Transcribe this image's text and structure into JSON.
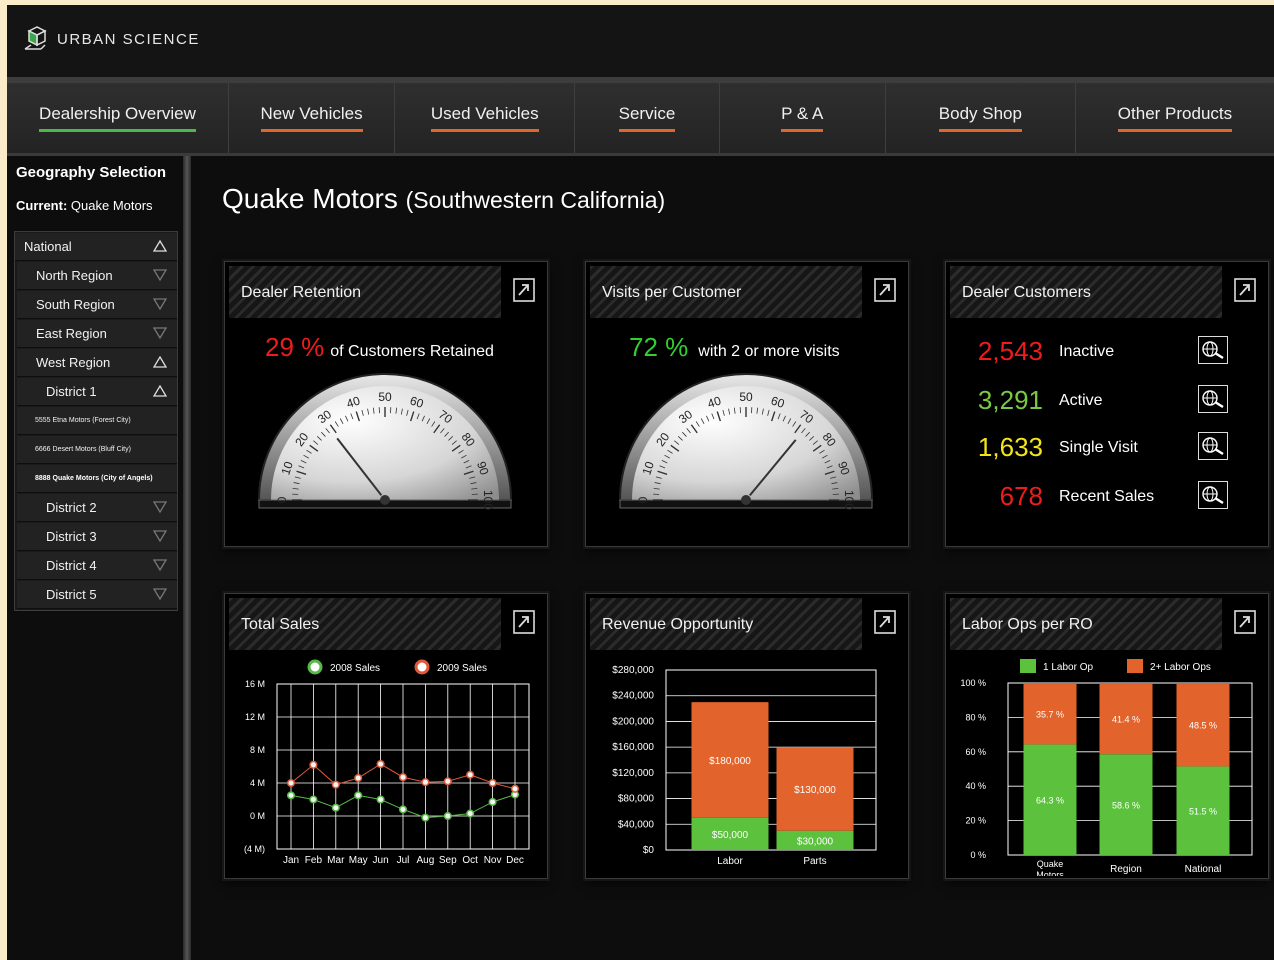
{
  "app": {
    "logo_text": "URBAN SCIENCE"
  },
  "nav": {
    "tabs": [
      {
        "label": "Dealership Overview",
        "active": true
      },
      {
        "label": "New Vehicles"
      },
      {
        "label": "Used Vehicles"
      },
      {
        "label": "Service"
      },
      {
        "label": "P & A"
      },
      {
        "label": "Body Shop"
      },
      {
        "label": "Other Products"
      }
    ]
  },
  "sidebar": {
    "title": "Geography Selection",
    "current_label": "Current:",
    "current_value": "Quake Motors",
    "items": [
      {
        "label": "National",
        "icon": "triangle-up-icon"
      },
      {
        "label": "North Region",
        "icon": "triangle-down-icon"
      },
      {
        "label": "South Region",
        "icon": "triangle-down-icon"
      },
      {
        "label": "East Region",
        "icon": "triangle-down-icon"
      },
      {
        "label": "West Region",
        "icon": "triangle-up-icon"
      },
      {
        "label": "District 1",
        "icon": "triangle-up-icon"
      },
      {
        "label": "5555 Etna Motors (Forest City)"
      },
      {
        "label": "6666 Desert Motors (Bluff City)"
      },
      {
        "label": "8888 Quake Motors (City of Angels)",
        "selected": true
      },
      {
        "label": "District 2",
        "icon": "triangle-down-icon"
      },
      {
        "label": "District 3",
        "icon": "triangle-down-icon"
      },
      {
        "label": "District 4",
        "icon": "triangle-down-icon"
      },
      {
        "label": "District 5",
        "icon": "triangle-down-icon"
      }
    ]
  },
  "main": {
    "title": "Quake Motors",
    "subtitle": "(Southwestern California)",
    "colors": {
      "red": "#ee1c1c",
      "green": "#30d030",
      "lime": "#7ac943",
      "yellow": "#f2e51b",
      "orange": "#e2642c",
      "tab_accent": "#e0672a",
      "active_accent": "#4cb848"
    },
    "retention": {
      "title": "Dealer Retention",
      "value": "29 %",
      "label": "of Customers Retained",
      "gauge_value": 29,
      "gauge_ticks": [
        "0",
        "10",
        "20",
        "30",
        "40",
        "50",
        "60",
        "70",
        "80",
        "90",
        "100"
      ]
    },
    "visits": {
      "title": "Visits per Customer",
      "value": "72 %",
      "label": "with 2 or more visits",
      "gauge_value": 72,
      "gauge_ticks": [
        "0",
        "10",
        "20",
        "30",
        "40",
        "50",
        "60",
        "70",
        "80",
        "90",
        "100"
      ]
    },
    "customers": {
      "title": "Dealer Customers",
      "rows": [
        {
          "value": "2,543",
          "label": "Inactive",
          "color": "#ee1c1c",
          "icon": "globe-search-icon"
        },
        {
          "value": "3,291",
          "label": "Active",
          "color": "#7ac943",
          "icon": "globe-search-icon"
        },
        {
          "value": "1,633",
          "label": "Single Visit",
          "color": "#f2e51b",
          "icon": "globe-search-icon"
        },
        {
          "value": "678",
          "label": "Recent Sales",
          "color": "#ee1c1c",
          "icon": "globe-search-icon"
        }
      ]
    },
    "total_sales": {
      "title": "Total Sales"
    },
    "revenue": {
      "title": "Revenue Opportunity"
    },
    "labor": {
      "title": "Labor Ops per RO"
    }
  },
  "chart_data": [
    {
      "type": "line",
      "title": "Total Sales",
      "categories": [
        "Jan",
        "Feb",
        "Mar",
        "May",
        "Jun",
        "Jul",
        "Aug",
        "Sep",
        "Oct",
        "Nov",
        "Dec"
      ],
      "ylim": [
        -4,
        16
      ],
      "yticks": [
        "16 M",
        "12 M",
        "8 M",
        "4 M",
        "0 M",
        "(4 M)"
      ],
      "ytick_values": [
        16,
        12,
        8,
        4,
        0,
        -4
      ],
      "series": [
        {
          "name": "2008 Sales",
          "color": "#58b848",
          "values": [
            2.5,
            2,
            1,
            2.5,
            2,
            0.8,
            -0.2,
            0,
            0.3,
            1.7,
            2.6
          ]
        },
        {
          "name": "2009 Sales",
          "color": "#e05a3a",
          "values": [
            4,
            6.2,
            3.8,
            4.6,
            6.3,
            4.7,
            4.1,
            4.2,
            5,
            4,
            3.3
          ]
        }
      ],
      "legend": "top",
      "grid": true
    },
    {
      "type": "bar",
      "stacked": true,
      "title": "Revenue Opportunity",
      "categories": [
        "Labor",
        "Parts"
      ],
      "ylim": [
        0,
        280000
      ],
      "yticks": [
        "$280,000",
        "$240,000",
        "$200,000",
        "$160,000",
        "$120,000",
        "$80,000",
        "$40,000",
        "$0"
      ],
      "ytick_values": [
        280000,
        240000,
        200000,
        160000,
        120000,
        80000,
        40000,
        0
      ],
      "series": [
        {
          "color": "#5cc23e",
          "values": [
            50000,
            30000
          ],
          "labels": [
            "$50,000",
            "$30,000"
          ]
        },
        {
          "color": "#e2642c",
          "values": [
            180000,
            130000
          ],
          "labels": [
            "$180,000",
            "$130,000"
          ]
        }
      ]
    },
    {
      "type": "bar",
      "stacked": true,
      "title": "Labor Ops per RO",
      "categories": [
        "Quake Motors",
        "Region",
        "National"
      ],
      "ylim": [
        0,
        100
      ],
      "yticks": [
        "100 %",
        "80 %",
        "60 %",
        "40 %",
        "20 %",
        "0 %"
      ],
      "ytick_values": [
        100,
        80,
        60,
        40,
        20,
        0
      ],
      "legend": "top",
      "series": [
        {
          "name": "1 Labor Op",
          "color": "#5cc23e",
          "values": [
            64.3,
            58.6,
            51.5
          ],
          "labels": [
            "64.3 %",
            "58.6 %",
            "51.5 %"
          ]
        },
        {
          "name": "2+ Labor Ops",
          "color": "#e2642c",
          "values": [
            35.7,
            41.4,
            48.5
          ],
          "labels": [
            "35.7 %",
            "41.4 %",
            "48.5 %"
          ]
        }
      ]
    }
  ]
}
